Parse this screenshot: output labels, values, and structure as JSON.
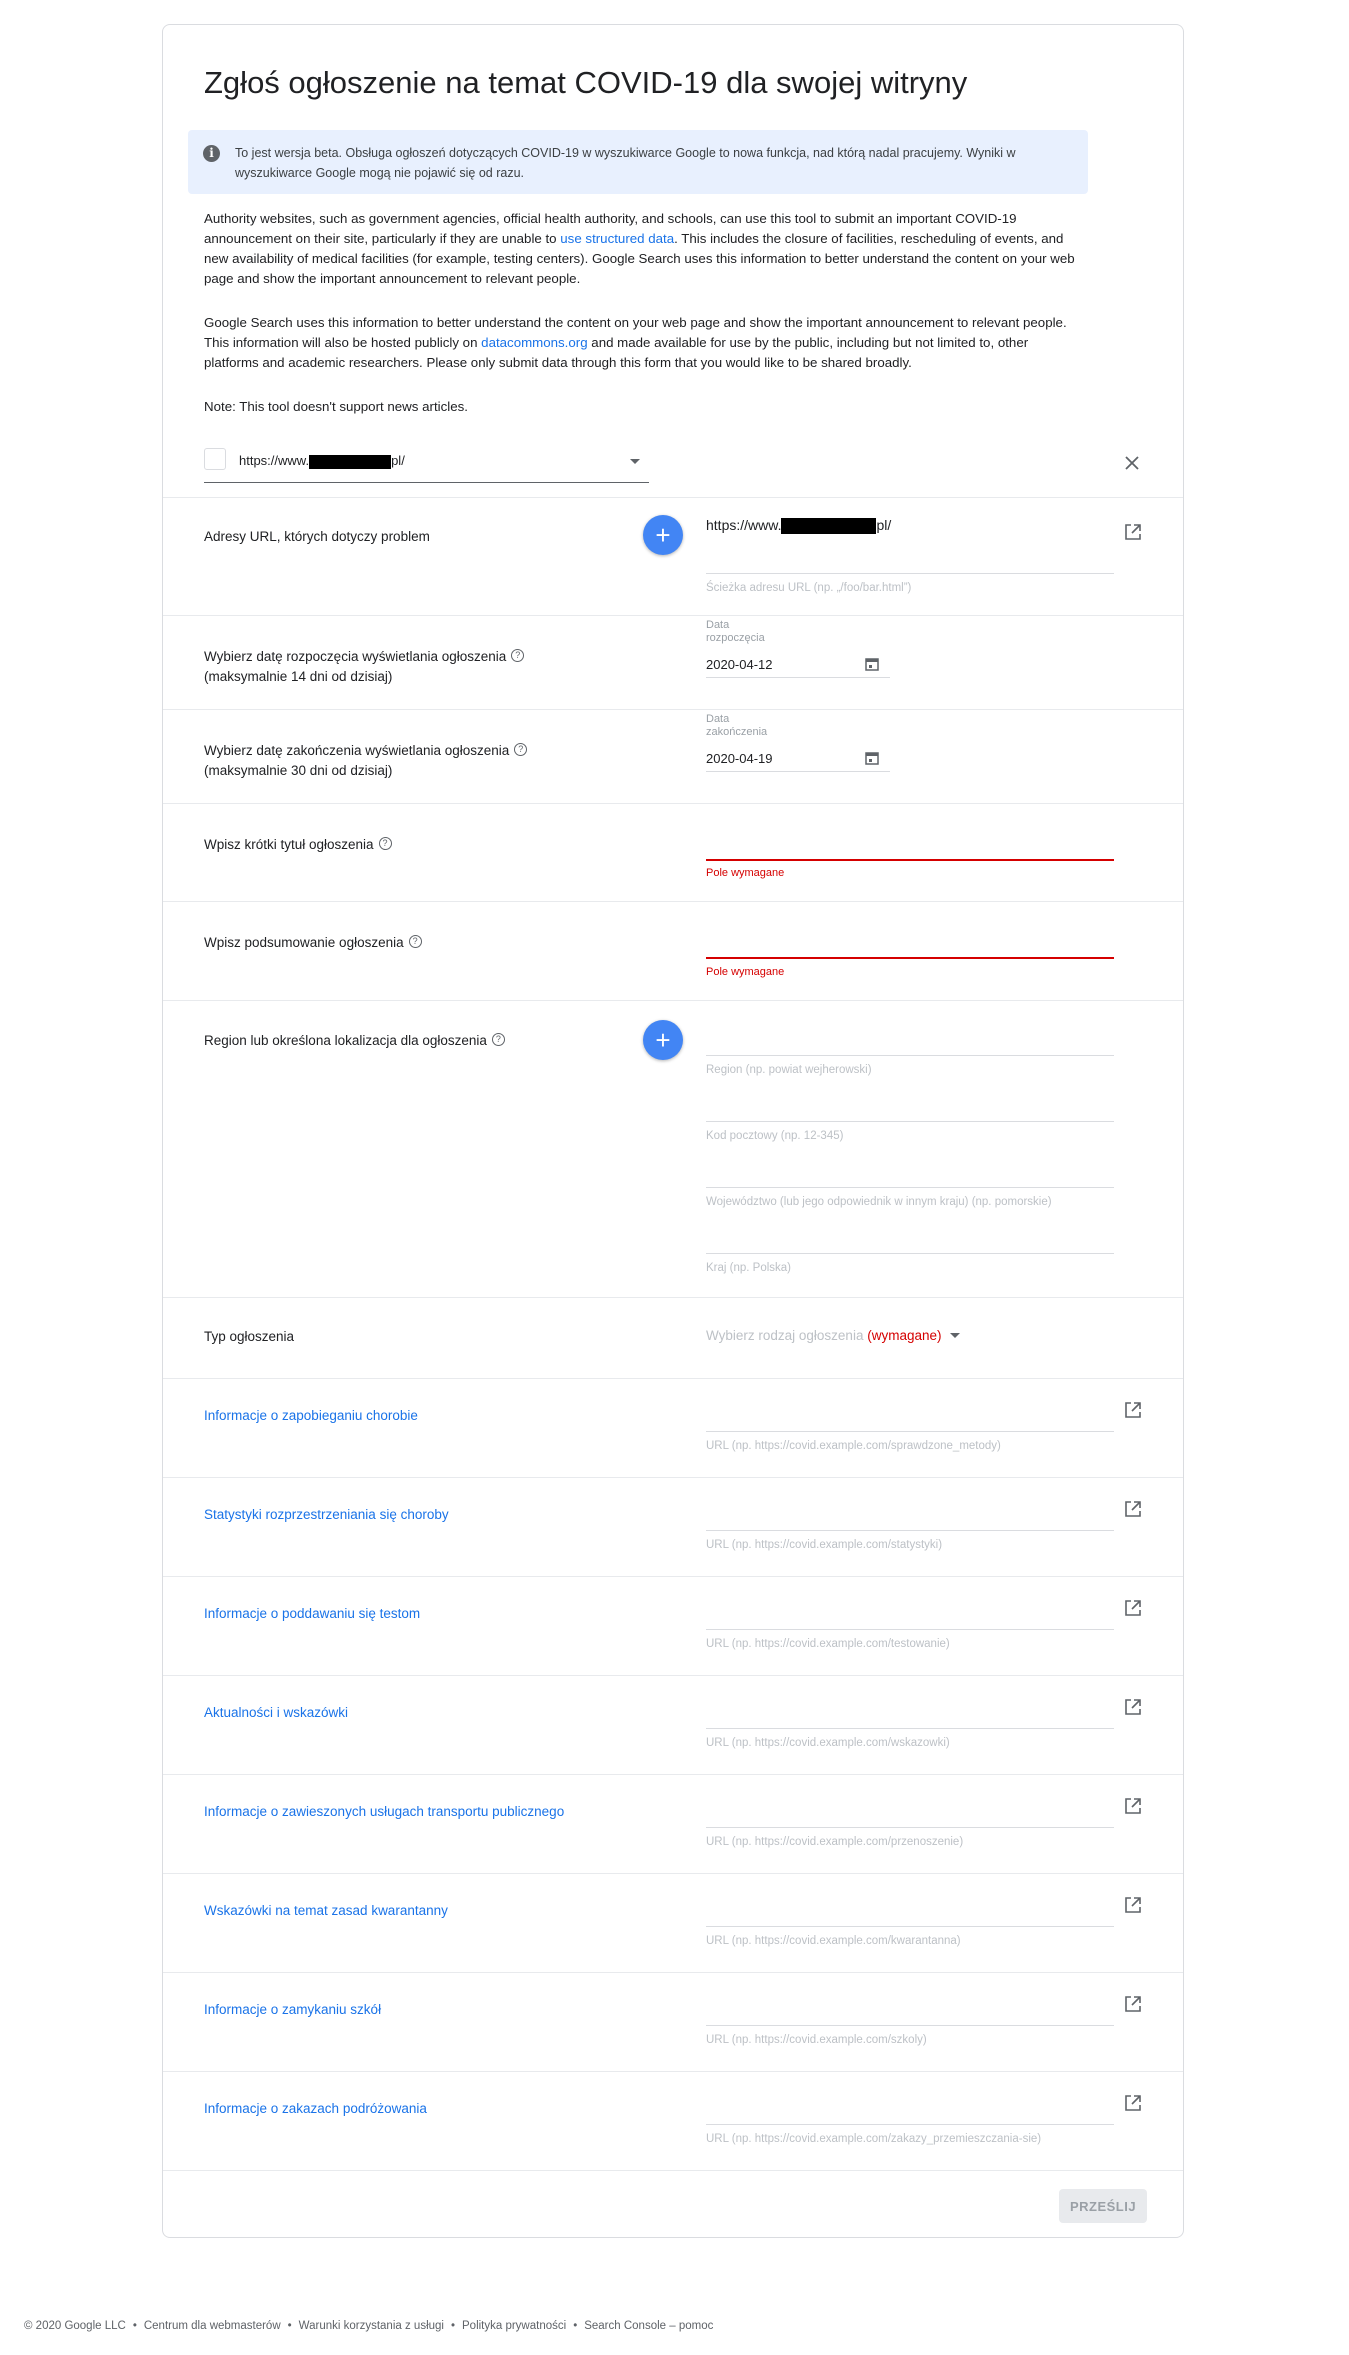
{
  "page": {
    "title": "Zgłoś ogłoszenie na temat COVID-19 dla swojej witryny",
    "beta_notice": "To jest wersja beta. Obsługa ogłoszeń dotyczących COVID-19 w wyszukiwarce Google to nowa funkcja, nad którą nadal pracujemy. Wyniki w wyszukiwarce Google mogą nie pojawić się od razu.",
    "intro": {
      "p1_before": "Authority websites, such as government agencies, official health authority, and schools, can use this tool to submit an important COVID-19 announcement on their site, particularly if they are unable to ",
      "p1_link": "use structured data",
      "p1_after": ". This includes the closure of facilities, rescheduling of events, and new availability of medical facilities (for example, testing centers). Google Search uses this information to better understand the content on your web page and show the important announcement to relevant people.",
      "p2_before": "Google Search uses this information to better understand the content on your web page and show the important announcement to relevant people. This information will also be hosted publicly on ",
      "p2_link": "datacommons.org",
      "p2_after": " and made available for use by the public, including but not limited to, other platforms and academic researchers. Please only submit data through this form that you would like to be shared broadly.",
      "note": "Note: This tool doesn't support news articles."
    },
    "site_selector": {
      "prefix": "https://www.",
      "suffix": "pl/"
    }
  },
  "urls_row": {
    "label": "Adresy URL, których dotyczy problem",
    "value_prefix": "https://www.",
    "value_suffix": "pl/",
    "path_hint": "Ścieżka adresu URL (np. „/foo/bar.html”)"
  },
  "start_date": {
    "label_line1": "Wybierz datę rozpoczęcia wyświetlania ogłoszenia",
    "label_line2": "(maksymalnie 14 dni od dzisiaj)",
    "field_label": "Data rozpoczęcia",
    "value": "2020-04-12"
  },
  "end_date": {
    "label_line1": "Wybierz datę zakończenia wyświetlania ogłoszenia",
    "label_line2": "(maksymalnie 30 dni od dzisiaj)",
    "field_label": "Data zakończenia",
    "value": "2020-04-19"
  },
  "short_title": {
    "label": "Wpisz krótki tytuł ogłoszenia",
    "error": "Pole wymagane"
  },
  "summary": {
    "label": "Wpisz podsumowanie ogłoszenia",
    "error": "Pole wymagane"
  },
  "location": {
    "label": "Region lub określona lokalizacja dla ogłoszenia",
    "region_hint": "Region (np. powiat wejherowski)",
    "postal_hint": "Kod pocztowy (np. 12-345)",
    "province_hint": "Województwo (lub jego odpowiednik w innym kraju) (np. pomorskie)",
    "country_hint": "Kraj (np. Polska)"
  },
  "announcement_type": {
    "label": "Typ ogłoszenia",
    "placeholder": "Wybierz rodzaj ogłoszenia",
    "required": "(wymagane)"
  },
  "links": [
    {
      "label": "Informacje o zapobieganiu chorobie",
      "hint": "URL (np. https://covid.example.com/sprawdzone_metody)"
    },
    {
      "label": "Statystyki rozprzestrzeniania się choroby",
      "hint": "URL (np. https://covid.example.com/statystyki)"
    },
    {
      "label": "Informacje o poddawaniu się testom",
      "hint": "URL (np. https://covid.example.com/testowanie)"
    },
    {
      "label": "Aktualności i wskazówki",
      "hint": "URL (np. https://covid.example.com/wskazowki)"
    },
    {
      "label": "Informacje o zawieszonych usługach transportu publicznego",
      "hint": "URL (np. https://covid.example.com/przenoszenie)"
    },
    {
      "label": "Wskazówki na temat zasad kwarantanny",
      "hint": "URL (np. https://covid.example.com/kwarantanna)"
    },
    {
      "label": "Informacje o zamykaniu szkół",
      "hint": "URL (np. https://covid.example.com/szkoly)"
    },
    {
      "label": "Informacje o zakazach podróżowania",
      "hint": "URL (np. https://covid.example.com/zakazy_przemieszczania-sie)"
    }
  ],
  "submit_label": "PRZEŚLIJ",
  "footer": [
    "© 2020 Google LLC",
    "Centrum dla webmasterów",
    "Warunki korzystania z usługi",
    "Polityka prywatności",
    "Search Console – pomoc"
  ],
  "icons": {
    "help": "help-icon",
    "open": "open-in-new-icon",
    "calendar": "calendar-icon",
    "close": "close-icon",
    "add": "add-icon",
    "info": "info-icon"
  },
  "colors": {
    "accent": "#1a73e8",
    "fab": "#4285f4",
    "error": "#d50000",
    "beta_bg": "#e8f0fe"
  }
}
